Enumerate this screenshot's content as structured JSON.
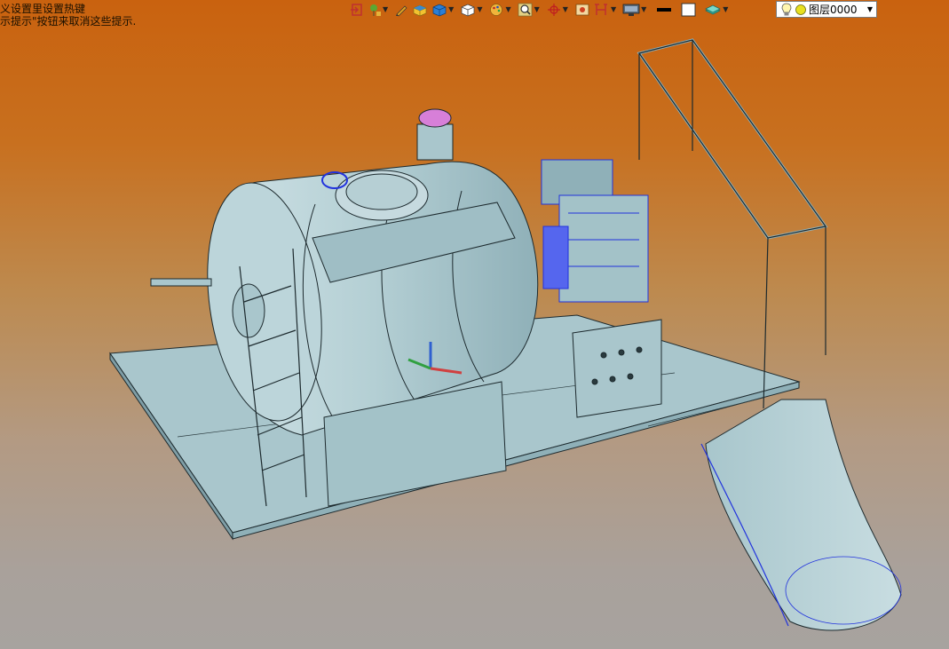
{
  "hint": {
    "line1": "义设置里设置热键",
    "line2": "示提示\"按钮来取消这些提示."
  },
  "toolbar": {
    "icons": [
      "exit-icon",
      "plant-icon",
      "pencil-icon",
      "box-yellow-icon",
      "cube-blue-icon",
      "cube-white-icon",
      "palette-icon",
      "zoom-icon",
      "axis-icon",
      "image-icon",
      "frame-icon",
      "monitor-icon",
      "line-black-icon",
      "square-white-icon",
      "layer-stack-icon"
    ]
  },
  "layer": {
    "name": "图层0000"
  },
  "colors": {
    "model": "#a9c6cc",
    "model_dark": "#7f9ea6",
    "edge": "#1d2a2e",
    "engine": "#2233dd",
    "accent_pink": "#d77fd8"
  }
}
